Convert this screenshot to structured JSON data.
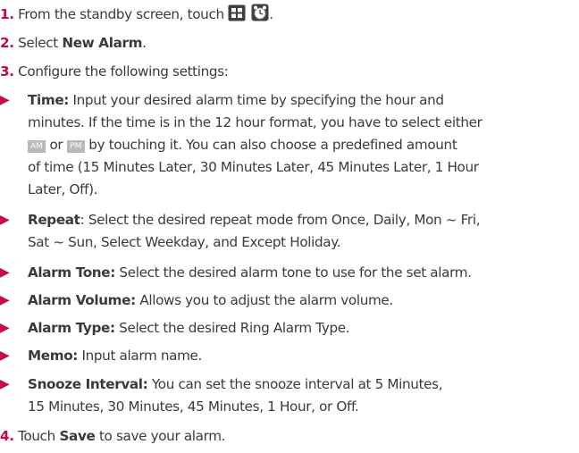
{
  "steps": {
    "s1_num": "1.",
    "s1_text": "From the standby screen, touch",
    "s1_icon1": "menu-grid-icon",
    "s1_icon2": "alarm-clock-icon",
    "s1_end": ".",
    "s2_num": "2.",
    "s2_pre": "Select",
    "s2_bold": "New Alarm",
    "s2_post": ".",
    "s3_num": "3.",
    "s3_text": "Configure the following settings:",
    "s4_num": "4.",
    "s4_pre": "Touch",
    "s4_bold": "Save",
    "s4_post": "to save your alarm."
  },
  "bullets": {
    "time_label": "Time:",
    "time_l1": "Input your desired alarm time by specifying the hour and",
    "time_l2": "minutes. If the time is in the 12 hour format, you have to select either",
    "time_am": "AM",
    "time_or": "or",
    "time_pm": "PM",
    "time_l3b": "by touching it. You can also choose a predefined amount",
    "time_l4": "of time (15 Minutes Later, 30 Minutes Later, 45 Minutes Later, 1 Hour",
    "time_l5": "Later, Off).",
    "repeat_label": "Repeat",
    "repeat_l1": ": Select the desired repeat mode from Once, Daily, Mon ~ Fri,",
    "repeat_l2": "Sat ~ Sun, Select Weekday, and Except Holiday.",
    "tone_label": "Alarm Tone:",
    "tone_text": "Select the desired alarm tone to use for the set alarm.",
    "volume_label": "Alarm Volume:",
    "volume_text": "Allows you to adjust the alarm volume.",
    "type_label": "Alarm Type:",
    "type_text": "Select the desired Ring Alarm Type.",
    "memo_label": "Memo:",
    "memo_text": "Input alarm name.",
    "snooze_label": "Snooze Interval:",
    "snooze_l1": "You can set the snooze interval at 5 Minutes,",
    "snooze_l2": "15 Minutes, 30 Minutes, 45 Minutes, 1 Hour, or Off."
  },
  "colors": {
    "accent": "#c4094e",
    "text": "#3a3a3a",
    "badge": "#b9b9b9"
  }
}
